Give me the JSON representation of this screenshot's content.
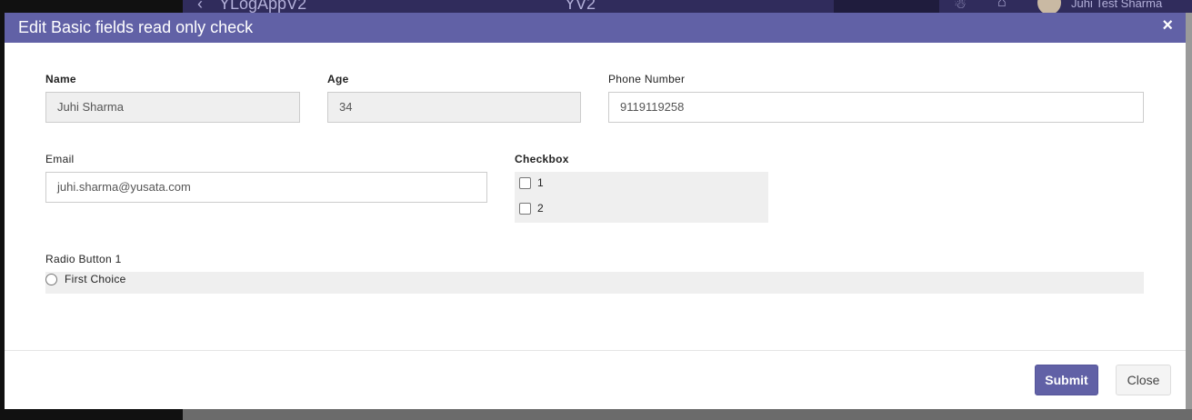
{
  "background": {
    "app_title": "YLogAppV2",
    "center_title": "YV2",
    "user_name": "Juhi Test Sharma"
  },
  "modal": {
    "title": "Edit Basic fields read only check",
    "close_symbol": "×",
    "fields": {
      "name": {
        "label": "Name",
        "value": "Juhi Sharma"
      },
      "age": {
        "label": "Age",
        "value": "34"
      },
      "phone": {
        "label": "Phone Number",
        "value": "9119119258"
      },
      "email": {
        "label": "Email",
        "value": "juhi.sharma@yusata.com"
      }
    },
    "checkbox": {
      "label": "Checkbox",
      "options": [
        "1",
        "2"
      ]
    },
    "radio": {
      "label": "Radio Button 1",
      "options": [
        "First Choice"
      ]
    },
    "footer": {
      "submit_label": "Submit",
      "close_label": "Close"
    }
  },
  "colors": {
    "header": "#6161a6",
    "submit": "#6161a6",
    "readonly_bg": "#efefef"
  },
  "icons": [
    "back-chevron-icon",
    "close-icon",
    "user-icon",
    "home-icon",
    "avatar"
  ]
}
